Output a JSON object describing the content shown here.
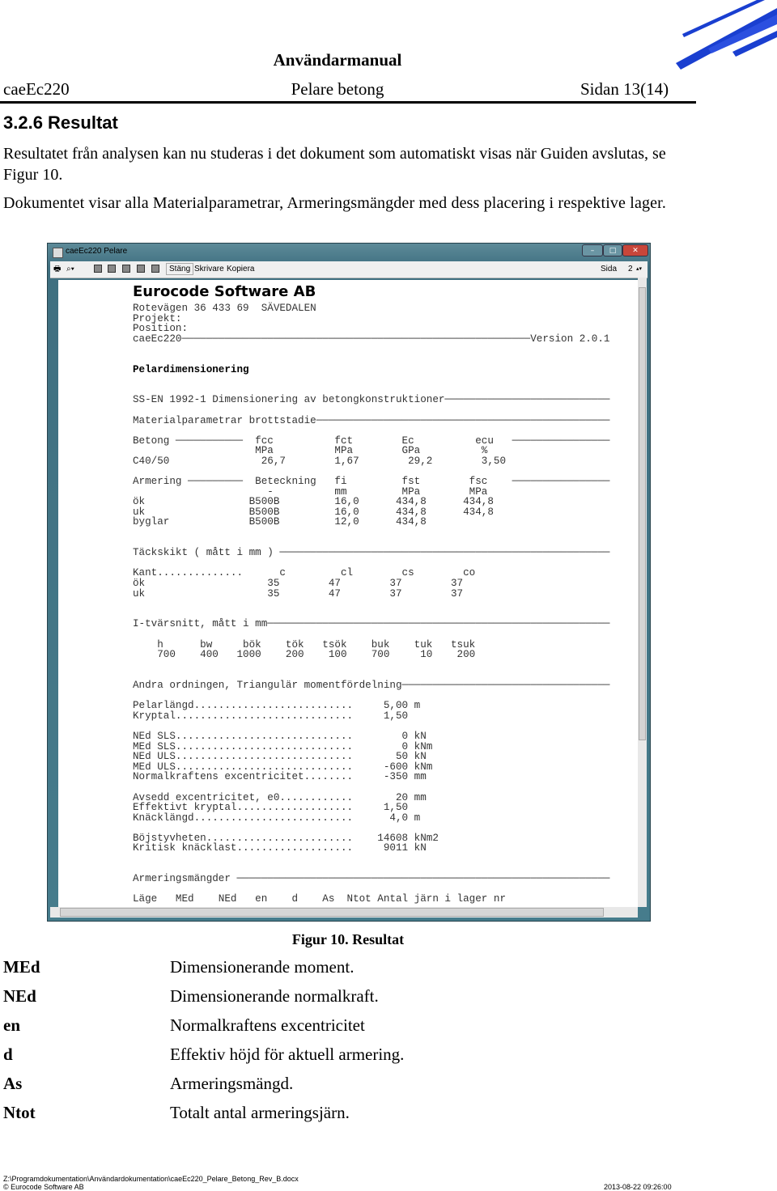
{
  "header": {
    "title": "Användarmanual",
    "left": "caeEc220",
    "center": "Pelare betong",
    "right": "Sidan 13(14)"
  },
  "section": {
    "heading": "3.2.6  Resultat",
    "paragraphs": [
      "Resultatet från analysen kan nu studeras i det dokument som automatiskt visas när Guiden avslutas, se Figur 10.",
      "Dokumentet visar alla Materialparametrar, Armeringsmängder med dess placering i respektive lager."
    ]
  },
  "window": {
    "title": "caeEc220 Pelare",
    "toolbar": {
      "close": "Stäng",
      "printer": "Skrivare",
      "copy": "Kopiera",
      "page_label": "Sida",
      "page_value": "2"
    },
    "company": "Eurocode Software AB",
    "report_lines": [
      {
        "t": "Rotevägen 36 433 69  SÄVEDALEN"
      },
      {
        "t": "Projekt:"
      },
      {
        "t": "Position:"
      },
      {
        "t": "caeEc220─────────────────────────────────────────────────────────Version 2.0.1"
      },
      {
        "t": ""
      },
      {
        "t": ""
      },
      {
        "t": "Pelardimensionering",
        "b": true
      },
      {
        "t": ""
      },
      {
        "t": ""
      },
      {
        "t": "SS-EN 1992-1 Dimensionering av betongkonstruktioner───────────────────────────"
      },
      {
        "t": ""
      },
      {
        "t": "Materialparametrar brottstadie────────────────────────────────────────────────"
      },
      {
        "t": ""
      },
      {
        "t": "Betong ───────────  fcc          fct        Ec          ecu   ────────────────"
      },
      {
        "t": "                    MPa          MPa        GPa          %"
      },
      {
        "t": "C40/50               26,7        1,67        29,2        3,50"
      },
      {
        "t": ""
      },
      {
        "t": "Armering ─────────  Beteckning   fi         fst        fsc    ────────────────"
      },
      {
        "t": "                      -          mm         MPa        MPa"
      },
      {
        "t": "ök                 B500B         16,0      434,8      434,8"
      },
      {
        "t": "uk                 B500B         16,0      434,8      434,8"
      },
      {
        "t": "byglar             B500B         12,0      434,8"
      },
      {
        "t": ""
      },
      {
        "t": ""
      },
      {
        "t": "Täckskikt ( mått i mm ) ──────────────────────────────────────────────────────"
      },
      {
        "t": ""
      },
      {
        "t": "Kant..............      c         cl        cs        co"
      },
      {
        "t": "ök                    35        47        37        37"
      },
      {
        "t": "uk                    35        47        37        37"
      },
      {
        "t": ""
      },
      {
        "t": ""
      },
      {
        "t": "I-tvärsnitt, mått i mm────────────────────────────────────────────────────────"
      },
      {
        "t": ""
      },
      {
        "t": "    h      bw     bök    tök   tsök    buk    tuk   tsuk"
      },
      {
        "t": "    700    400   1000    200    100    700     10    200"
      },
      {
        "t": ""
      },
      {
        "t": ""
      },
      {
        "t": "Andra ordningen, Triangulär momentfördelning──────────────────────────────────"
      },
      {
        "t": ""
      },
      {
        "t": "Pelarlängd..........................     5,00 m"
      },
      {
        "t": "Kryptal.............................     1,50"
      },
      {
        "t": ""
      },
      {
        "t": "NEd SLS.............................        0 kN"
      },
      {
        "t": "MEd SLS.............................        0 kNm"
      },
      {
        "t": "NEd ULS.............................       50 kN"
      },
      {
        "t": "MEd ULS.............................     -600 kNm"
      },
      {
        "t": "Normalkraftens excentricitet........     -350 mm"
      },
      {
        "t": ""
      },
      {
        "t": "Avsedd excentricitet, e0............       20 mm"
      },
      {
        "t": "Effektivt kryptal...................     1,50"
      },
      {
        "t": "Knäcklängd..........................      4,0 m"
      },
      {
        "t": ""
      },
      {
        "t": "Böjstyvheten........................    14608 kNm2"
      },
      {
        "t": "Kritisk knäcklast...................     9011 kN"
      },
      {
        "t": ""
      },
      {
        "t": ""
      },
      {
        "t": "Armeringsmängder ─────────────────────────────────────────────────────────────"
      },
      {
        "t": ""
      },
      {
        "t": "Läge   MEd    NEd   en    d    As  Ntot Antal järn i lager nr"
      }
    ]
  },
  "figure": {
    "caption": "Figur 10. Resultat"
  },
  "definitions": [
    {
      "term": "MEd",
      "desc": "Dimensionerande moment."
    },
    {
      "term": "NEd",
      "desc": "Dimensionerande normalkraft."
    },
    {
      "term": "en",
      "desc": "Normalkraftens excentricitet"
    },
    {
      "term": "d",
      "desc": "Effektiv höjd för aktuell armering."
    },
    {
      "term": "As",
      "desc": "Armeringsmängd."
    },
    {
      "term": "Ntot",
      "desc": "Totalt antal armeringsjärn."
    }
  ],
  "footer": {
    "path": "Z:\\Programdokumentation\\Användardokumentation\\caeEc220_Pelare_Betong_Rev_B.docx",
    "copyright": "© Eurocode Software AB",
    "date": "2013-08-22 09:26:00"
  },
  "colors": {
    "logo_blue": "#1a3fd0",
    "window_frame": "#467c8c"
  }
}
